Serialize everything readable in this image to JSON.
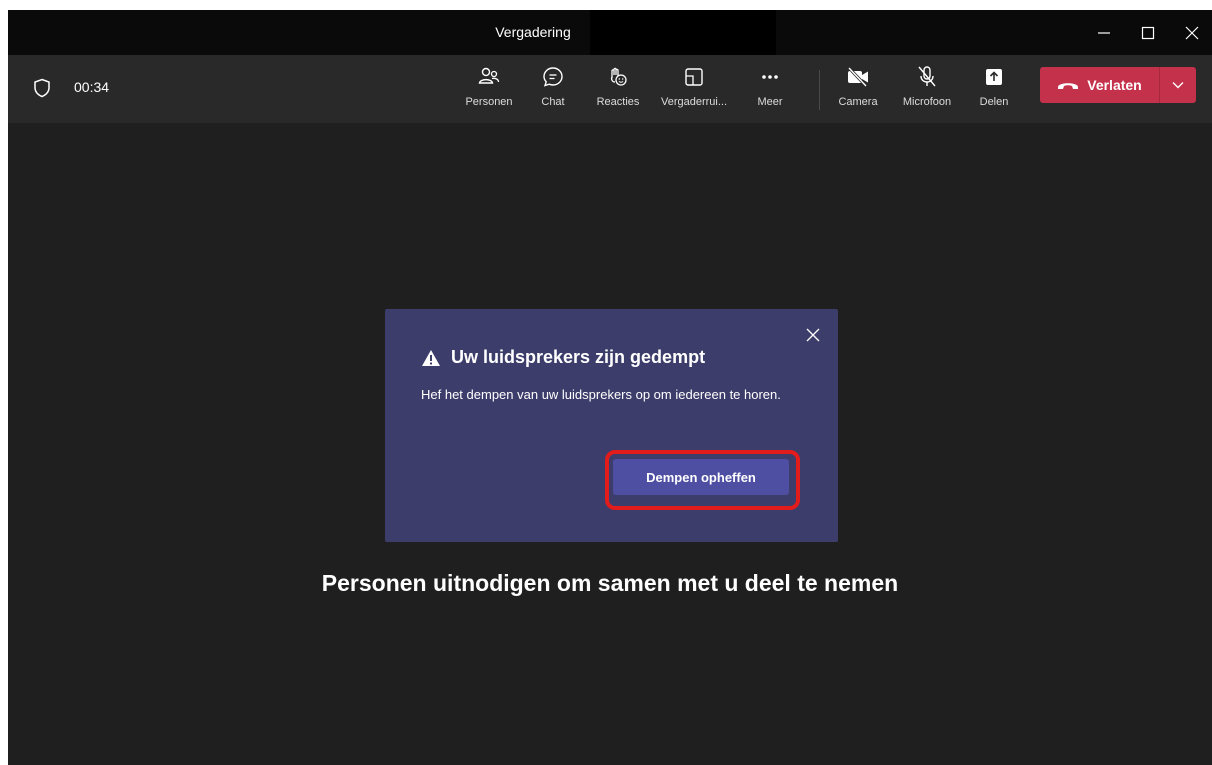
{
  "window": {
    "title": "Vergadering"
  },
  "toolbar": {
    "timer": "00:34",
    "items": [
      {
        "label": "Personen",
        "icon": "people-icon"
      },
      {
        "label": "Chat",
        "icon": "chat-icon"
      },
      {
        "label": "Reacties",
        "icon": "reactions-icon"
      },
      {
        "label": "Vergaderrui...",
        "icon": "rooms-icon"
      },
      {
        "label": "Meer",
        "icon": "more-icon"
      },
      {
        "label": "Camera",
        "icon": "camera-off-icon"
      },
      {
        "label": "Microfoon",
        "icon": "mic-off-icon"
      },
      {
        "label": "Delen",
        "icon": "share-icon"
      }
    ],
    "leave_label": "Verlaten"
  },
  "popup": {
    "title": "Uw luidsprekers zijn gedempt",
    "body": "Hef het dempen van uw luidsprekers op om iedereen te horen.",
    "button_label": "Dempen opheffen"
  },
  "stage": {
    "invite_text": "Personen uitnodigen om samen met u deel te nemen"
  },
  "colors": {
    "leave": "#c4314b",
    "popup_bg": "#3d3d6b",
    "button": "#4e4fa3",
    "highlight": "#e21b1b"
  }
}
